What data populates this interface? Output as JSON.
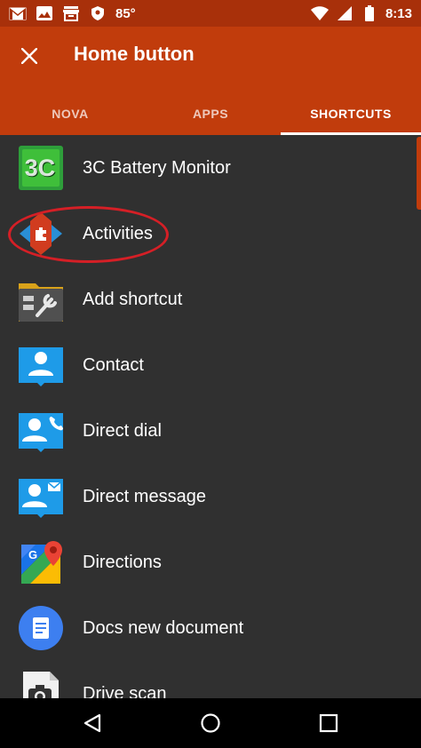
{
  "status_bar": {
    "temperature": "85°",
    "time": "8:13",
    "icons": [
      "gmail-icon",
      "photos-icon",
      "store-icon",
      "vpn-shield-icon",
      "wifi-icon",
      "signal-icon",
      "battery-icon"
    ]
  },
  "header": {
    "title": "Home button",
    "close_icon": "close-icon"
  },
  "tabs": [
    {
      "label": "NOVA",
      "active": false
    },
    {
      "label": "APPS",
      "active": false
    },
    {
      "label": "SHORTCUTS",
      "active": true
    }
  ],
  "list": {
    "items": [
      {
        "label": "3C Battery Monitor",
        "icon": "battery-monitor-icon"
      },
      {
        "label": "Activities",
        "icon": "nova-activities-icon"
      },
      {
        "label": "Add shortcut",
        "icon": "add-shortcut-icon"
      },
      {
        "label": "Contact",
        "icon": "contact-icon"
      },
      {
        "label": "Direct dial",
        "icon": "direct-dial-icon"
      },
      {
        "label": "Direct message",
        "icon": "direct-message-icon"
      },
      {
        "label": "Directions",
        "icon": "maps-directions-icon"
      },
      {
        "label": "Docs new document",
        "icon": "docs-icon"
      },
      {
        "label": "Drive scan",
        "icon": "drive-scan-icon"
      }
    ]
  },
  "navigation": {
    "buttons": [
      "back-icon",
      "home-icon",
      "recents-icon"
    ]
  },
  "colors": {
    "status_bar": "#a8300a",
    "app_bar": "#c13c0c",
    "list_background": "#303030",
    "highlight_ring": "#d51f26"
  }
}
